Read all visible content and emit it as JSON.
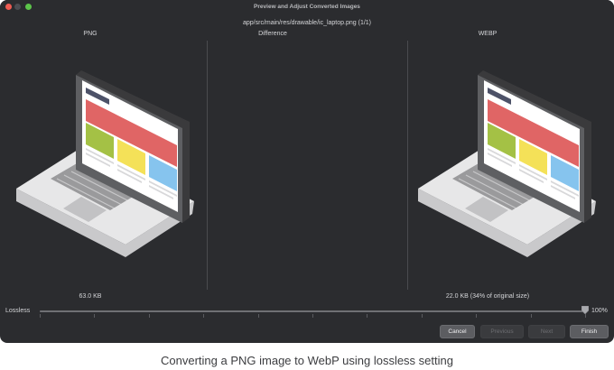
{
  "window": {
    "title": "Preview and Adjust Converted Images",
    "path": "app/src/main/res/drawable/ic_laptop.png (1/1)"
  },
  "columns": {
    "left_header": "PNG",
    "middle_header": "Difference",
    "right_header": "WEBP",
    "left_size": "63.0 KB",
    "right_size": "22.0 KB (34% of original size)"
  },
  "quality": {
    "label": "Lossless",
    "value_label": "100%",
    "value_fraction": 1.0
  },
  "buttons": {
    "cancel": "Cancel",
    "previous": "Previous",
    "next": "Next",
    "finish": "Finish"
  },
  "caption": "Converting a PNG image to WebP using lossless setting",
  "colors": {
    "window_bg": "#2b2c2f",
    "banner_red": "#e06565",
    "tile_green": "#a4c145",
    "tile_yellow": "#f4e158",
    "tile_blue": "#86c4ee"
  }
}
